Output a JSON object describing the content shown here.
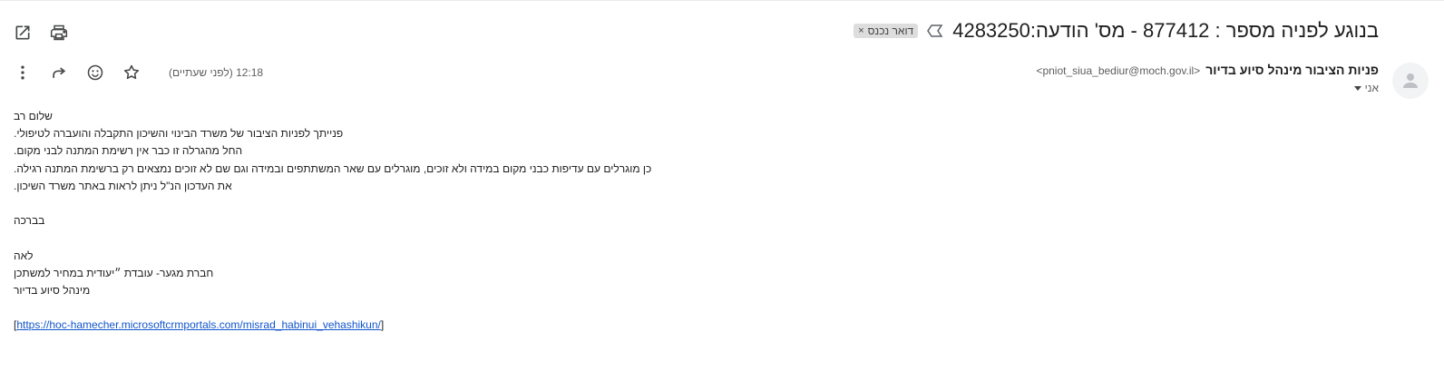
{
  "header": {
    "subject": "בנוגע לפניה מספר : 877412 - מס' הודעה:4283250",
    "label_chip": "דואר נכנס",
    "label_chip_close": "×",
    "icons": {
      "open_new_window": "open-in-new-window-icon",
      "print": "print-icon",
      "important": "important-marker-icon"
    }
  },
  "sender": {
    "name": "פניות הציבור מינהל סיוע בדיור",
    "email": "<pniot_siua_bediur@moch.gov.il>",
    "to": "אני"
  },
  "meta": {
    "timestamp": "12:18 (לפני שעתיים)"
  },
  "body": {
    "lines": [
      "שלום רב",
      "פנייתך לפניות הציבור של משרד הבינוי והשיכון התקבלה והועברה לטיפולי.",
      "החל מהגרלה זו כבר אין רשימת המתנה לבני מקום.",
      "כן מוגרלים עם עדיפות כבני מקום במידה ולא זוכים, מוגרלים עם שאר המשתתפים ובמידה וגם שם לא זוכים נמצאים רק ברשימת המתנה רגילה.",
      "את העדכון הנ\"ל ניתן לראות באתר משרד השיכון.",
      "",
      "בברכה",
      "",
      "לאה",
      "חברת מגער- עובדת ״יעודית במחיר למשתכן",
      "מינהל סיוע בדיור",
      ""
    ],
    "link_prefix": "[",
    "link_text": "https://hoc-hamecher.microsoftcrmportals.com/misrad_habinui_vehashikun/",
    "link_suffix": "]"
  }
}
